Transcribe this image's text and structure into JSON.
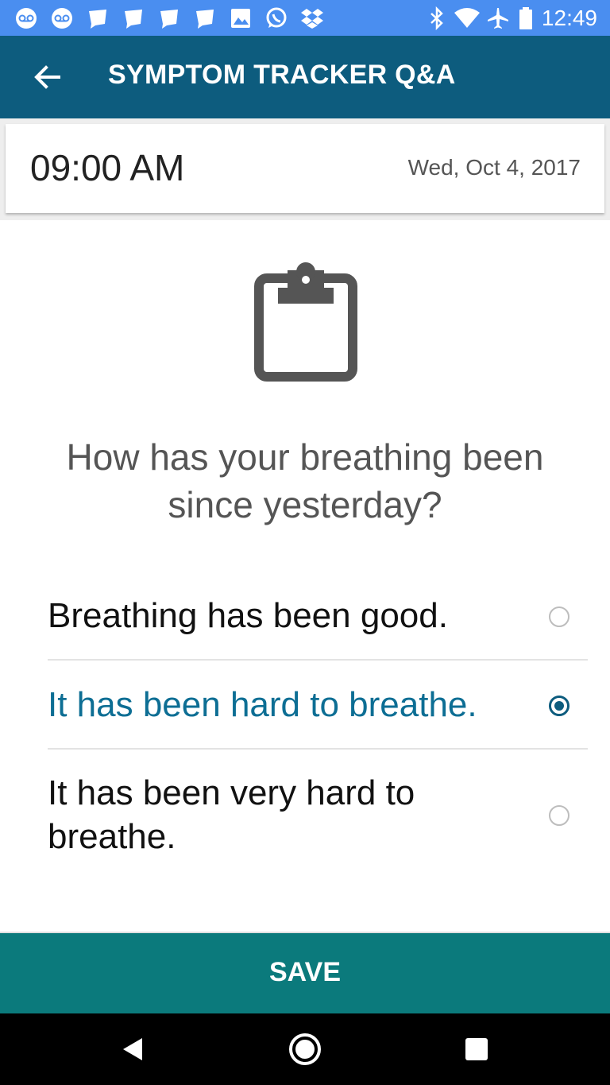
{
  "status_bar": {
    "time": "12:49",
    "left_icons": [
      "voicemail-icon",
      "voicemail-icon",
      "chat-bubble-icon",
      "chat-bubble-icon",
      "chat-bubble-icon",
      "chat-bubble-icon",
      "image-icon",
      "whatsapp-icon",
      "dropbox-icon"
    ],
    "right_icons": [
      "bluetooth-icon",
      "wifi-icon",
      "airplane-icon",
      "battery-icon"
    ]
  },
  "app_bar": {
    "title": "SYMPTOM TRACKER Q&A",
    "back_icon": "arrow-back-icon"
  },
  "entry": {
    "time": "09:00 AM",
    "date": "Wed, Oct 4, 2017"
  },
  "question": {
    "icon": "clipboard-icon",
    "text": "How has your breathing been since yesterday?"
  },
  "options": [
    {
      "label": "Breathing has been good.",
      "selected": false
    },
    {
      "label": "It has been hard to breathe.",
      "selected": true
    },
    {
      "label": "It has been very hard to breathe.",
      "selected": false
    }
  ],
  "save_button": {
    "label": "SAVE"
  },
  "colors": {
    "status_bar": "#4a8ef0",
    "app_bar": "#0d5c7e",
    "accent_selected": "#0d6e94",
    "save_button": "#0b7a7c"
  }
}
